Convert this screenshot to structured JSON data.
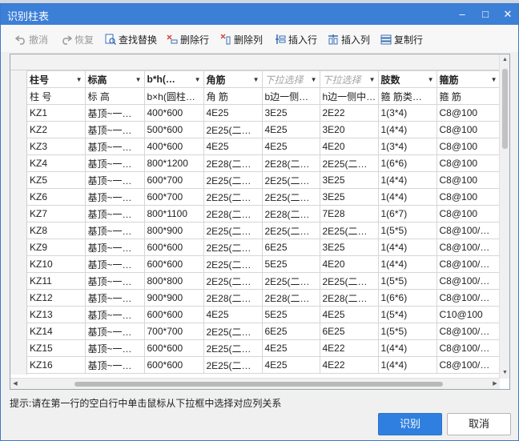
{
  "window": {
    "title": "识别柱表"
  },
  "toolbar": {
    "items": [
      {
        "label": "撤消",
        "icon": "undo-icon"
      },
      {
        "label": "恢复",
        "icon": "redo-icon"
      },
      {
        "label": "查找替换",
        "icon": "find-replace-icon"
      },
      {
        "label": "删除行",
        "icon": "delete-row-icon"
      },
      {
        "label": "删除列",
        "icon": "delete-column-icon"
      },
      {
        "label": "插入行",
        "icon": "insert-row-icon"
      },
      {
        "label": "插入列",
        "icon": "insert-column-icon"
      },
      {
        "label": "复制行",
        "icon": "copy-row-icon"
      }
    ]
  },
  "table": {
    "mapping_row": [
      "柱号",
      "标高",
      "b*h(…",
      "角筋",
      "下拉选择",
      "下拉选择",
      "肢数",
      "箍筋"
    ],
    "source_row": [
      "柱 号",
      "标 高",
      "b×h(圆柱…",
      "角 筋",
      "b边一侧…",
      "h边一侧中…",
      "箍 筋类…",
      "箍 筋"
    ],
    "rows": [
      [
        "KZ1",
        "基顶~一…",
        "400*600",
        "4E25",
        "3E25",
        "2E22",
        "1(3*4)",
        "C8@100"
      ],
      [
        "KZ2",
        "基顶~一…",
        "500*600",
        "2E25(二…",
        "4E25",
        "3E20",
        "1(4*4)",
        "C8@100"
      ],
      [
        "KZ3",
        "基顶~一…",
        "400*600",
        "4E25",
        "4E25",
        "4E20",
        "1(3*4)",
        "C8@100"
      ],
      [
        "KZ4",
        "基顶~一…",
        "800*1200",
        "2E28(二…",
        "2E28(二…",
        "2E25(二…",
        "1(6*6)",
        "C8@100"
      ],
      [
        "KZ5",
        "基顶~一…",
        "600*700",
        "2E25(二…",
        "2E25(二…",
        "3E25",
        "1(4*4)",
        "C8@100"
      ],
      [
        "KZ6",
        "基顶~一…",
        "600*700",
        "2E25(二…",
        "2E25(二…",
        "3E25",
        "1(4*4)",
        "C8@100"
      ],
      [
        "KZ7",
        "基顶~一…",
        "800*1100",
        "2E28(二…",
        "2E28(二…",
        "7E28",
        "1(6*7)",
        "C8@100"
      ],
      [
        "KZ8",
        "基顶~一…",
        "800*900",
        "2E25(二…",
        "2E25(二…",
        "2E25(二…",
        "1(5*5)",
        "C8@100/…"
      ],
      [
        "KZ9",
        "基顶~一…",
        "600*600",
        "2E25(二…",
        "6E25",
        "3E25",
        "1(4*4)",
        "C8@100/…"
      ],
      [
        "KZ10",
        "基顶~一…",
        "600*600",
        "2E25(二…",
        "5E25",
        "4E20",
        "1(4*4)",
        "C8@100/…"
      ],
      [
        "KZ11",
        "基顶~一…",
        "800*800",
        "2E25(二…",
        "2E25(二…",
        "2E25(二…",
        "1(5*5)",
        "C8@100/…"
      ],
      [
        "KZ12",
        "基顶~一…",
        "900*900",
        "2E28(二…",
        "2E28(二…",
        "2E28(二…",
        "1(6*6)",
        "C8@100/…"
      ],
      [
        "KZ13",
        "基顶~一…",
        "600*600",
        "4E25",
        "5E25",
        "4E25",
        "1(5*4)",
        "C10@100"
      ],
      [
        "KZ14",
        "基顶~一…",
        "700*700",
        "2E25(二…",
        "6E25",
        "6E25",
        "1(5*5)",
        "C8@100/…"
      ],
      [
        "KZ15",
        "基顶~一…",
        "600*600",
        "2E25(二…",
        "4E25",
        "4E22",
        "1(4*4)",
        "C8@100/…"
      ],
      [
        "KZ16",
        "基顶~一…",
        "600*600",
        "2E25(二…",
        "4E25",
        "4E22",
        "1(4*4)",
        "C8@100/…"
      ]
    ]
  },
  "hint": "提示:请在第一行的空白行中单击鼠标从下拉框中选择对应列关系",
  "buttons": {
    "ok": "识别",
    "cancel": "取消"
  },
  "colors": {
    "titlebar": "#3c7fd7",
    "primary_button": "#2f7fe0"
  }
}
